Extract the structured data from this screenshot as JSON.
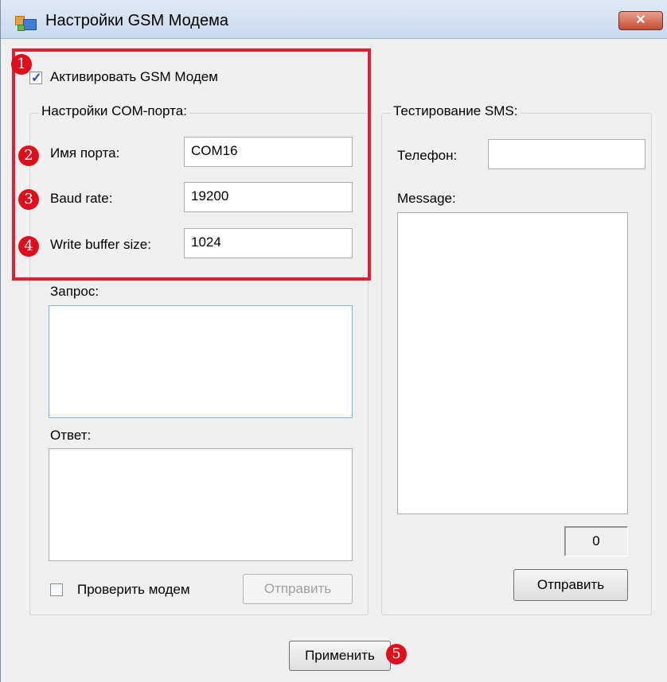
{
  "window": {
    "title": "Настройки GSM Модема",
    "close_label": "✕"
  },
  "activate": {
    "label": "Активировать GSM Модем",
    "checked": true
  },
  "com_port": {
    "legend": "Настройки COM-порта:",
    "port_name_label": "Имя порта:",
    "port_name_value": "COM16",
    "baud_rate_label": "Baud rate:",
    "baud_rate_value": "19200",
    "write_buffer_label": "Write buffer size:",
    "write_buffer_value": "1024",
    "request_label": "Запрос:",
    "request_value": "",
    "response_label": "Ответ:",
    "response_value": "",
    "check_modem_label": "Проверить модем",
    "check_modem_checked": false,
    "send_label": "Отправить"
  },
  "sms_test": {
    "legend": "Тестирование SMS:",
    "phone_label": "Телефон:",
    "phone_value": "",
    "message_label": "Message:",
    "message_value": "",
    "char_count": "0",
    "send_label": "Отправить"
  },
  "apply_label": "Применить",
  "markers": [
    "1",
    "2",
    "3",
    "4",
    "5"
  ],
  "colors": {
    "highlight": "#e31e34",
    "marker": "#e00d1c"
  }
}
